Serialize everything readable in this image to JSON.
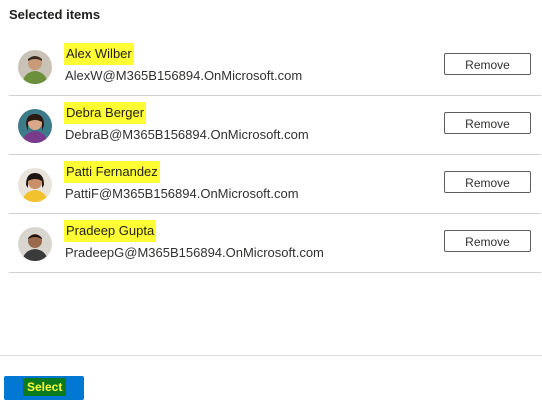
{
  "section": {
    "title": "Selected items"
  },
  "items": [
    {
      "name": "Alex Wilber",
      "email": "AlexW@M365B156894.OnMicrosoft.com",
      "remove_label": "Remove"
    },
    {
      "name": "Debra Berger",
      "email": "DebraB@M365B156894.OnMicrosoft.com",
      "remove_label": "Remove"
    },
    {
      "name": "Patti Fernandez",
      "email": "PattiF@M365B156894.OnMicrosoft.com",
      "remove_label": "Remove"
    },
    {
      "name": "Pradeep Gupta",
      "email": "PradeepG@M365B156894.OnMicrosoft.com",
      "remove_label": "Remove"
    }
  ],
  "footer": {
    "select_label": "Select"
  },
  "colors": {
    "highlight": "#ffff33",
    "primary_button": "#0078d4",
    "select_highlight": "#0a7a1f"
  }
}
